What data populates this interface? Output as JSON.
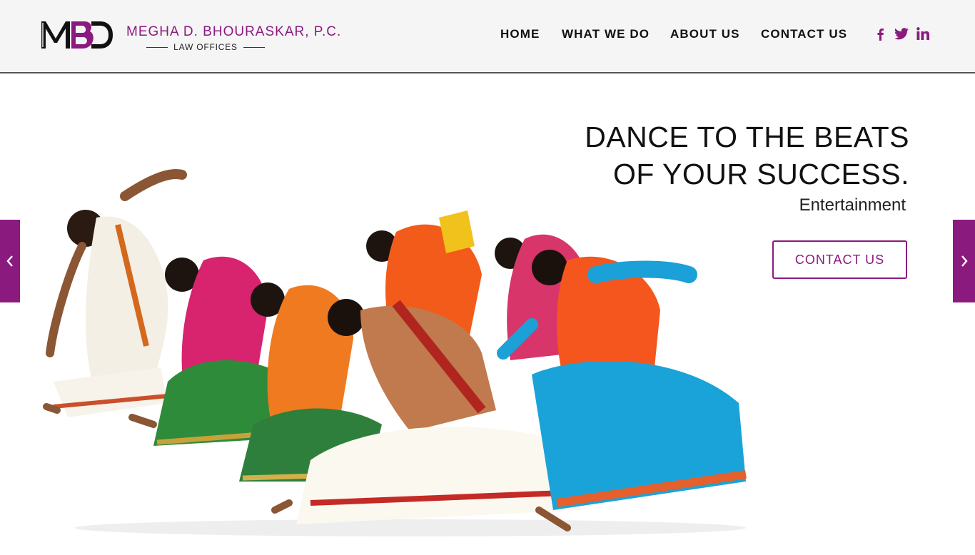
{
  "brand": {
    "logo_text": "MBD",
    "name": "MEGHA D. BHOURASKAR, P.C.",
    "subtitle": "LAW OFFICES"
  },
  "nav": {
    "items": [
      {
        "label": "HOME"
      },
      {
        "label": "WHAT WE DO"
      },
      {
        "label": "ABOUT US"
      },
      {
        "label": "CONTACT US"
      }
    ]
  },
  "social": [
    {
      "icon": "facebook-icon"
    },
    {
      "icon": "twitter-icon"
    },
    {
      "icon": "linkedin-icon"
    }
  ],
  "hero": {
    "title_line1": "DANCE TO THE BEATS",
    "title_line2": "OF YOUR SUCCESS.",
    "subtitle": "Entertainment",
    "cta_label": "CONTACT US",
    "image": "group of classical dancers in colorful sarees bending forward"
  },
  "slider": {
    "prev_icon": "chevron-left-icon",
    "next_icon": "chevron-right-icon"
  },
  "colors": {
    "accent": "#8b1a7f",
    "header_bg": "#f5f5f5",
    "text": "#111111"
  }
}
